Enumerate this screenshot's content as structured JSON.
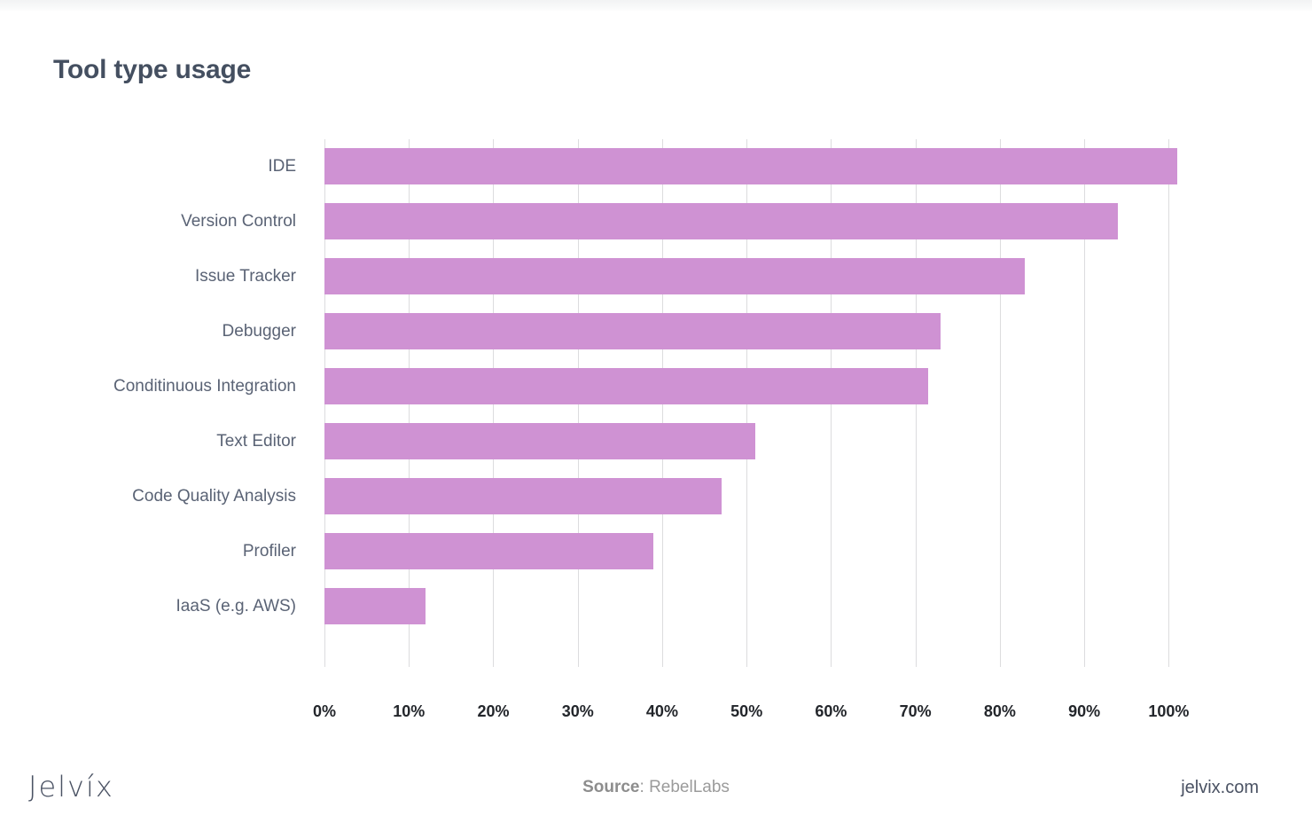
{
  "header": {
    "title": "Tool type usage"
  },
  "footer": {
    "logo": "Jelvíx",
    "source_key": "Source",
    "source_sep": ": ",
    "source_value": "RebelLabs",
    "site": "jelvix.com"
  },
  "colors": {
    "bar": "#cf92d3",
    "title": "#444f60",
    "category_label": "#5a6375",
    "tick_label": "#23262b",
    "gridline": "#dcdcde",
    "background": "#ffffff",
    "source_text": "#9b9b9b"
  },
  "chart_data": {
    "type": "bar",
    "orientation": "horizontal",
    "title": "Tool type usage",
    "xlabel": "",
    "ylabel": "",
    "xlim": [
      0,
      105
    ],
    "grid": "vertical",
    "legend": "none",
    "source": "RebelLabs",
    "xticks": [
      "0%",
      "10%",
      "20%",
      "30%",
      "40%",
      "50%",
      "60%",
      "70%",
      "80%",
      "90%",
      "100%"
    ],
    "xtick_values": [
      0,
      10,
      20,
      30,
      40,
      50,
      60,
      70,
      80,
      90,
      100
    ],
    "categories": [
      "IDE",
      "Version Control",
      "Issue Tracker",
      "Debugger",
      "Conditinuous Integration",
      "Text Editor",
      "Code Quality Analysis",
      "Profiler",
      "IaaS (e.g. AWS)"
    ],
    "values": [
      101,
      94,
      83,
      73,
      71.5,
      51,
      47,
      39,
      12
    ],
    "unit": "%"
  }
}
